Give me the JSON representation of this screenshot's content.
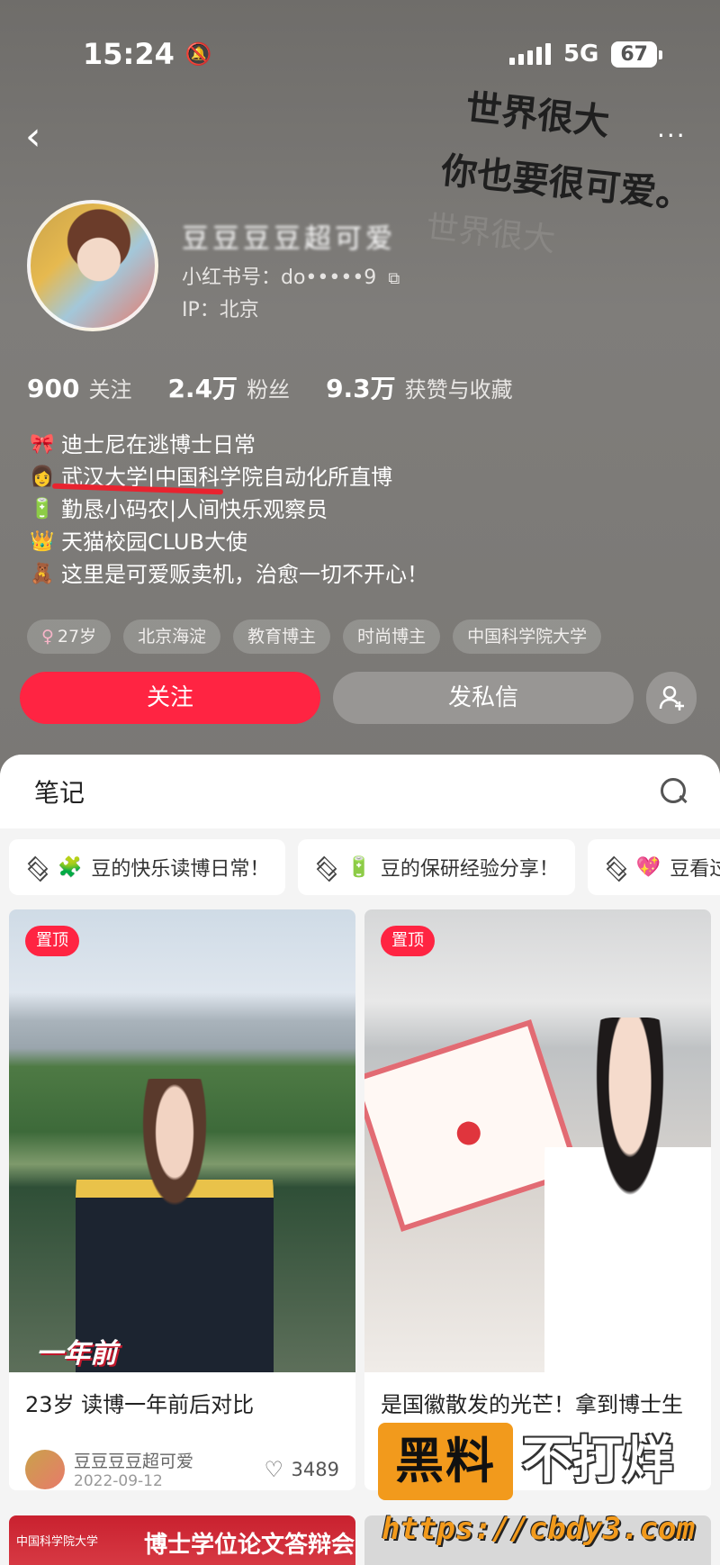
{
  "status_bar": {
    "time": "15:24",
    "network": "5G",
    "battery": "67"
  },
  "header": {
    "handwriting": {
      "line1": "世界很大",
      "line2": "你也要很可爱。",
      "ghost": "世界很大"
    },
    "username": "豆豆豆豆超可爱",
    "user_id": "小红书号：do•••••9",
    "ip": "IP：北京"
  },
  "stats": [
    {
      "num": "900",
      "label": "关注"
    },
    {
      "num": "2.4万",
      "label": "粉丝"
    },
    {
      "num": "9.3万",
      "label": "获赞与收藏"
    }
  ],
  "bio": [
    {
      "emoji": "🎀",
      "text": "迪士尼在逃博士日常"
    },
    {
      "emoji": "👩",
      "text": "武汉大学|中国科学院自动化所直博"
    },
    {
      "emoji": "🔋",
      "text": "勤恳小码农|人间快乐观察员"
    },
    {
      "emoji": "👑",
      "text": "天猫校园CLUB大使"
    },
    {
      "emoji": "🧸",
      "text": "这里是可爱贩卖机，治愈一切不开心！"
    }
  ],
  "tags": [
    {
      "icon": "♀",
      "text": "27岁"
    },
    {
      "text": "北京海淀"
    },
    {
      "text": "教育博主"
    },
    {
      "text": "时尚博主"
    },
    {
      "text": "中国科学院大学"
    }
  ],
  "actions": {
    "follow": "关注",
    "message": "发私信"
  },
  "notes": {
    "title": "笔记",
    "collections": [
      {
        "emoji": "🧩",
        "text": "豆的快乐读博日常！"
      },
      {
        "emoji": "🔋",
        "text": "豆的保研经验分享！"
      },
      {
        "emoji": "💖",
        "text": "豆看过"
      }
    ],
    "cards": [
      {
        "badge": "置顶",
        "image_caption": "一年前",
        "title": "23岁 读博一年前后对比",
        "author": "豆豆豆豆超可爱",
        "date": "2022-09-12",
        "likes": "3489"
      },
      {
        "badge": "置顶",
        "title": "是国徽散发的光芒！拿到博士生国家奖学金啦",
        "author": "",
        "date": "",
        "likes": ""
      }
    ],
    "row2_left": {
      "small": "中国科学院大学",
      "big": "博士学位论文答辩会"
    }
  },
  "watermark": {
    "box": "黑料",
    "text": "不打烊",
    "url": "https://cbdy3.com"
  },
  "colors": {
    "accent": "#ff2442",
    "header_bg": "#7d7b78",
    "watermark_orange": "#f29a1c"
  }
}
